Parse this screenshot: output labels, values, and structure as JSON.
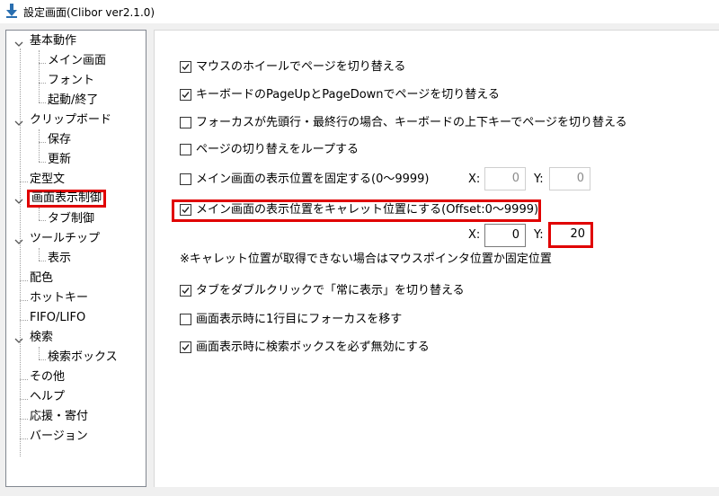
{
  "window": {
    "title": "設定画面(Clibor ver2.1.0)"
  },
  "tree": [
    {
      "label": "基本動作",
      "expanded": true
    },
    {
      "label": "メイン画面"
    },
    {
      "label": "フォント"
    },
    {
      "label": "起動/終了"
    },
    {
      "label": "クリップボード",
      "expanded": true
    },
    {
      "label": "保存"
    },
    {
      "label": "更新"
    },
    {
      "label": "定型文"
    },
    {
      "label": "画面表示制御",
      "expanded": true,
      "selected": true
    },
    {
      "label": "タブ制御"
    },
    {
      "label": "ツールチップ",
      "expanded": true
    },
    {
      "label": "表示"
    },
    {
      "label": "配色"
    },
    {
      "label": "ホットキー"
    },
    {
      "label": "FIFO/LIFO"
    },
    {
      "label": "検索",
      "expanded": true
    },
    {
      "label": "検索ボックス"
    },
    {
      "label": "その他"
    },
    {
      "label": "ヘルプ"
    },
    {
      "label": "応援・寄付"
    },
    {
      "label": "バージョン"
    }
  ],
  "options": {
    "wheel": {
      "label": "マウスのホイールでページを切り替える",
      "checked": true
    },
    "keyboard": {
      "label": "キーボードのPageUpとPageDownでページを切り替える",
      "checked": true
    },
    "focus_updown": {
      "label": "フォーカスが先頭行・最終行の場合、キーボードの上下キーでページを切り替える",
      "checked": false
    },
    "loop": {
      "label": "ページの切り替えをループする",
      "checked": false
    },
    "fixed_pos": {
      "label": "メイン画面の表示位置を固定する(0〜9999)",
      "checked": false
    },
    "caret_pos": {
      "label": "メイン画面の表示位置をキャレット位置にする(Offset:0〜9999)",
      "checked": true
    },
    "tab_dblclick": {
      "label": "タブをダブルクリックで「常に表示」を切り替える",
      "checked": true
    },
    "focus_first": {
      "label": "画面表示時に1行目にフォーカスを移す",
      "checked": false
    },
    "disable_search": {
      "label": "画面表示時に検索ボックスを必ず無効にする",
      "checked": true
    }
  },
  "fixed_coords": {
    "x_label": "X:",
    "x_value": "0",
    "y_label": "Y:",
    "y_value": "0"
  },
  "caret_coords": {
    "x_label": "X:",
    "x_value": "0",
    "y_label": "Y:",
    "y_value": "20"
  },
  "note": "※キャレット位置が取得できない場合はマウスポインタ位置か固定位置",
  "colors": {
    "highlight": "#e00000"
  }
}
